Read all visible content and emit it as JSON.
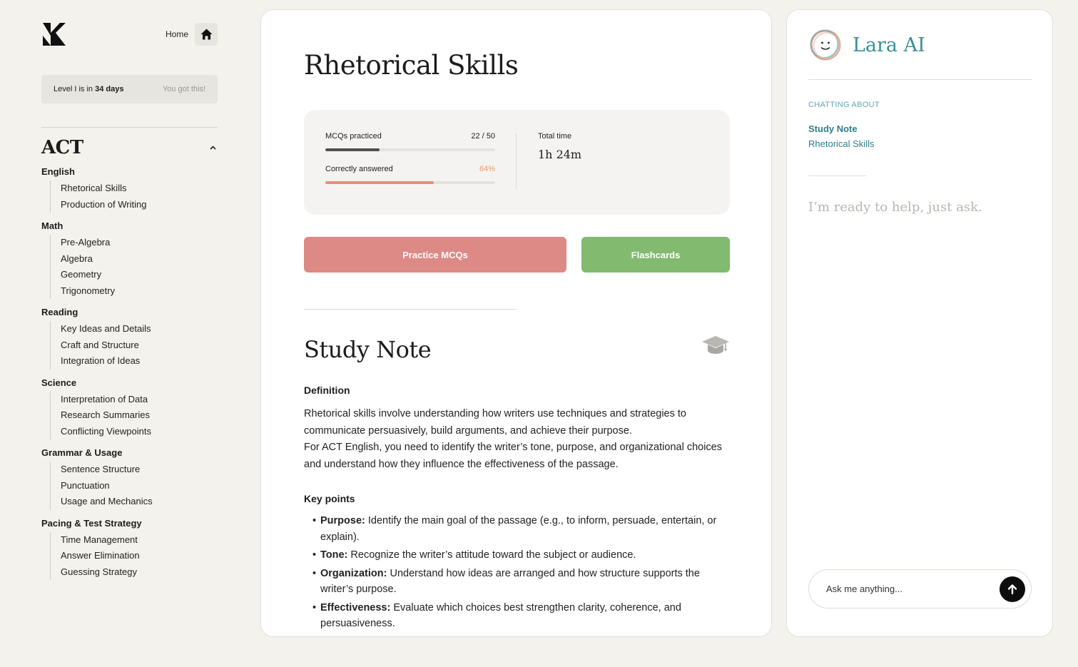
{
  "sidebar": {
    "home_label": "Home",
    "level_text": "Level I is in",
    "level_days": "34 days",
    "encouragement": "You got this!",
    "exam_title": "ACT",
    "subjects": [
      {
        "name": "English",
        "topics": [
          "Rhetorical Skills",
          "Production of Writing"
        ]
      },
      {
        "name": "Math",
        "topics": [
          "Pre-Algebra",
          "Algebra",
          "Geometry",
          "Trigonometry"
        ]
      },
      {
        "name": "Reading",
        "topics": [
          "Key Ideas and Details",
          "Craft and Structure",
          "Integration of Ideas"
        ]
      },
      {
        "name": "Science",
        "topics": [
          "Interpretation of Data",
          "Research Summaries",
          "Conflicting Viewpoints"
        ]
      },
      {
        "name": "Grammar & Usage",
        "topics": [
          "Sentence Structure",
          "Punctuation",
          "Usage and Mechanics"
        ]
      },
      {
        "name": "Pacing & Test Strategy",
        "topics": [
          "Time Management",
          "Answer Elimination",
          "Guessing Strategy"
        ]
      }
    ]
  },
  "main": {
    "title": "Rhetorical Skills",
    "stats": {
      "mcq_label": "MCQs practiced",
      "mcq_value": "22 / 50",
      "mcq_progress": 0.32,
      "correct_label": "Correctly answered",
      "correct_value": "64%",
      "correct_progress": 0.64,
      "time_label": "Total time",
      "time_value": "1h 24m"
    },
    "practice_button": "Practice MCQs",
    "flashcards_button": "Flashcards",
    "note_title": "Study Note",
    "definition_heading": "Definition",
    "definition_paragraphs": [
      "Rhetorical skills involve understanding how writers use techniques and strategies to communicate persuasively, build arguments, and achieve their purpose.",
      "For ACT English, you need to identify the writer’s tone, purpose, and organizational choices and understand how they influence the effectiveness of the passage."
    ],
    "key_points_heading": "Key points",
    "key_points": [
      {
        "term": "Purpose:",
        "text": "Identify the main goal of the passage (e.g., to inform, persuade, entertain, or explain)."
      },
      {
        "term": "Tone:",
        "text": "Recognize the writer’s attitude toward the subject or audience."
      },
      {
        "term": "Organization:",
        "text": "Understand how ideas are arranged and how structure supports the writer’s purpose."
      },
      {
        "term": "Effectiveness:",
        "text": "Evaluate which choices best strengthen clarity, coherence, and persuasiveness."
      }
    ]
  },
  "assistant": {
    "name": "Lara AI",
    "chatting_label": "CHATTING ABOUT",
    "context_primary": "Study Note",
    "context_secondary": "Rhetorical Skills",
    "ready_text": "I’m ready to help, just ask.",
    "input_placeholder": "Ask me anything..."
  },
  "colors": {
    "accent_teal": "#3a8f94",
    "practice_red": "#dd8a86",
    "flashcards_green": "#82ba70",
    "progress_dark": "#4f4f4f",
    "progress_salmon": "#e59077"
  },
  "icons": [
    "logo-icon",
    "home-icon",
    "chevron-up-icon",
    "graduation-cap-icon",
    "avatar-icon",
    "arrow-up-icon"
  ]
}
